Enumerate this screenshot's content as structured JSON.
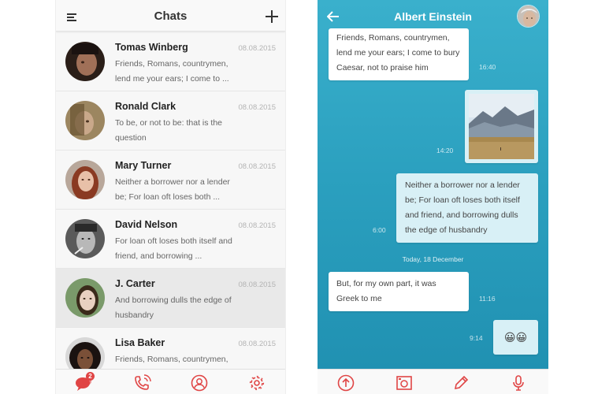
{
  "chats_screen": {
    "title": "Chats",
    "icons": {
      "menu": "menu-icon",
      "add": "plus-icon"
    },
    "chats": [
      {
        "name": "Tomas Winberg",
        "date": "08.08.2015",
        "preview": "Friends, Romans, countrymen, lend me your ears; I come to ..."
      },
      {
        "name": "Ronald Clark",
        "date": "08.08.2015",
        "preview": "To be, or not to be: that is the question"
      },
      {
        "name": "Mary Turner",
        "date": "08.08.2015",
        "preview": "Neither a borrower nor a lender be; For loan oft loses both ..."
      },
      {
        "name": "David Nelson",
        "date": "08.08.2015",
        "preview": "For loan oft loses both itself and friend, and borrowing ..."
      },
      {
        "name": "J. Carter",
        "date": "08.08.2015",
        "preview": "And borrowing dulls the edge of husbandry"
      },
      {
        "name": "Lisa Baker",
        "date": "08.08.2015",
        "preview": "Friends, Romans, countrymen, lend me your ears; I come to ..."
      }
    ],
    "tabbar": {
      "chats_badge": "2",
      "icons": [
        "chat-bubbles-icon",
        "phone-call-icon",
        "contacts-icon",
        "settings-gear-icon"
      ]
    }
  },
  "conversation_screen": {
    "contact_name": "Albert Einstein",
    "icons": {
      "back": "back-arrow-icon",
      "avatar": "avatar"
    },
    "messages": [
      {
        "direction": "in",
        "text": "Friends, Romans, countrymen, lend me your ears; I come to bury Caesar, not to praise him",
        "time": "16:40"
      },
      {
        "direction": "out",
        "type": "image",
        "time": "14:20"
      },
      {
        "direction": "out",
        "text": "Neither a borrower nor a lender be; For loan oft loses both itself and friend, and borrowing dulls the edge of husbandry",
        "time": "6:00"
      },
      {
        "direction": "in",
        "text": "But, for my own part, it was Greek to me",
        "time": "11:16"
      },
      {
        "direction": "out",
        "text": "😀😀",
        "time": "9:14"
      }
    ],
    "day_separator": "Today, 18 December",
    "tabbar": {
      "icons": [
        "upload-icon",
        "camera-icon",
        "pencil-icon",
        "microphone-icon"
      ]
    }
  },
  "colors": {
    "accent_red": "#e04545",
    "conversation_bg": "#2ba0bf",
    "bubble_out": "#d8f0f6",
    "bubble_in": "#ffffff"
  }
}
